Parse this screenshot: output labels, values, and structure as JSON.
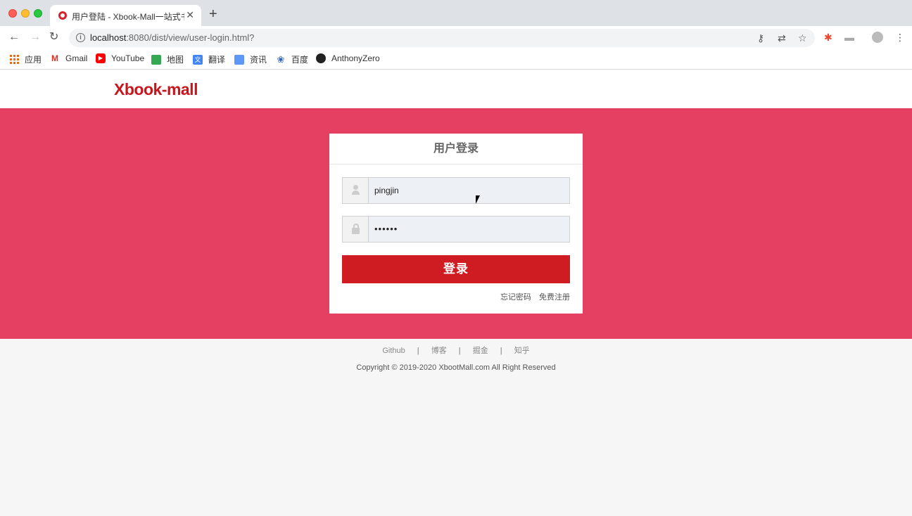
{
  "browser": {
    "tab_title": "用户登陆 - Xbook-Mall一站式书",
    "tab_close": "✕",
    "new_tab": "+",
    "url_host": "localhost",
    "url_rest": ":8080/dist/view/user-login.html?",
    "bookmarks": [
      {
        "label": "应用",
        "icon": "apps-icon"
      },
      {
        "label": "Gmail",
        "icon": "gmail-icon"
      },
      {
        "label": "YouTube",
        "icon": "youtube-icon"
      },
      {
        "label": "地图",
        "icon": "maps-icon"
      },
      {
        "label": "翻译",
        "icon": "translate-icon"
      },
      {
        "label": "资讯",
        "icon": "news-icon"
      },
      {
        "label": "百度",
        "icon": "baidu-icon"
      },
      {
        "label": "AnthonyZero",
        "icon": "github-icon"
      }
    ]
  },
  "header": {
    "logo": "Xbook-mall"
  },
  "login": {
    "title": "用户登录",
    "username": "pingjin",
    "password_masked": "••••••",
    "submit_label": "登录",
    "forgot_label": "忘记密码",
    "register_label": "免费注册"
  },
  "footer": {
    "links": [
      "Github",
      "博客",
      "掘金",
      "知乎"
    ],
    "separator": "|",
    "copyright": "Copyright © 2019-2020 XbootMall.com All Right Reserved"
  },
  "colors": {
    "brand_red": "#c8161d",
    "banner_pink": "#e53f62",
    "button_red": "#cf1c22"
  }
}
